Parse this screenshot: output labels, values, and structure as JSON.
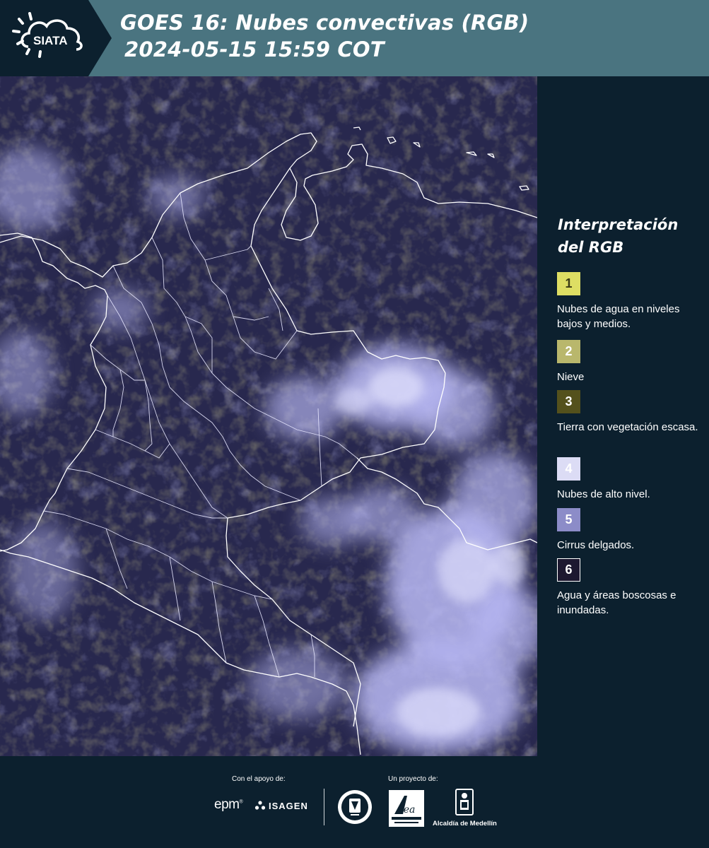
{
  "header": {
    "logo_text": "SIATA",
    "title_line1": "GOES 16: Nubes convectivas (RGB)",
    "title_line2": "2024-05-15 15:59 COT"
  },
  "legend": {
    "title": "Interpretación del RGB",
    "items": [
      {
        "number": "1",
        "description": "Nubes de agua en niveles bajos y medios.",
        "color": "#dede63",
        "text_color": "#3a3a14"
      },
      {
        "number": "2",
        "description": "Nieve",
        "color": "#b9b76c",
        "text_color": "#ffffff"
      },
      {
        "number": "3",
        "description": "Tierra con vegetación escasa.",
        "color": "#54511c",
        "text_color": "#ffffff"
      },
      {
        "number": "4",
        "description": "Nubes de alto nivel.",
        "color": "#dcdcf5",
        "text_color": "#ffffff"
      },
      {
        "number": "5",
        "description": "Cirrus delgados.",
        "color": "#8c8cc8",
        "text_color": "#ffffff"
      },
      {
        "number": "6",
        "description": "Agua y áreas boscosas e inundadas.",
        "color": "#1d1830",
        "text_color": "#ffffff"
      }
    ]
  },
  "footer": {
    "support_label": "Con el apoyo de:",
    "project_label": "Un proyecto de:",
    "sponsors": {
      "epm": "epm",
      "isagen": "ISAGEN"
    },
    "alcaldia": "Alcaldía de Medellín"
  }
}
